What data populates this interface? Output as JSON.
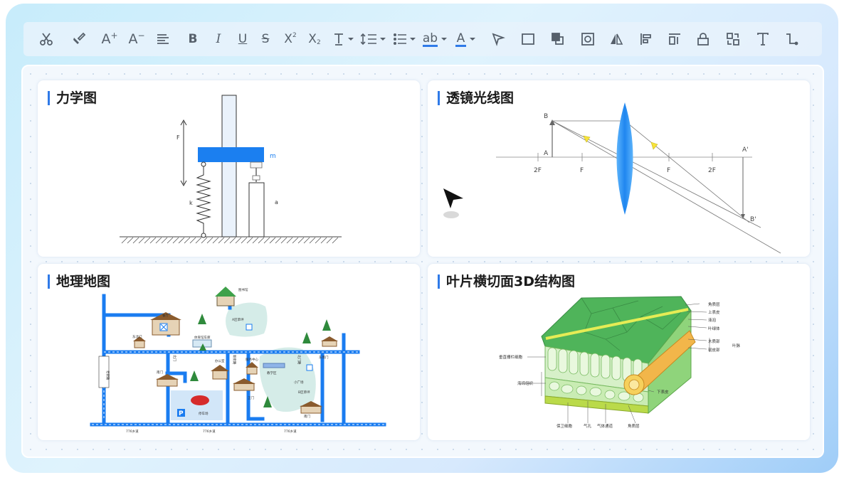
{
  "toolbar": {
    "underline_label": "ab",
    "buttons": [
      "cut",
      "format-painter",
      "increase-font",
      "decrease-font",
      "align",
      "bold",
      "italic",
      "underline",
      "strikethrough",
      "superscript",
      "subscript",
      "text-size",
      "line-spacing",
      "list",
      "text-underline-color",
      "font-color",
      "select",
      "rectangle",
      "crop",
      "group",
      "flip",
      "align-left",
      "distribute",
      "lock",
      "replace",
      "text",
      "connector"
    ]
  },
  "cards": {
    "mechanics": {
      "title": "力学图",
      "label_f": "F",
      "label_m": "m",
      "label_k": "k",
      "label_a": "a"
    },
    "lens": {
      "title": "透镜光线图",
      "label_b": "B",
      "label_a": "A",
      "label_2f_left": "2F",
      "label_f_left": "F",
      "label_f_right": "F",
      "label_2f_right": "2F",
      "label_a_prime": "A'",
      "label_b_prime": "B'"
    },
    "map": {
      "title": "地理地图",
      "labels": {
        "dining": "餐厅",
        "east_gate": "东北门",
        "playground": "体育馆车库",
        "park": "A区草坪",
        "library": "图书馆",
        "north_gate": "北门路",
        "office": "办公室",
        "service": "服务中心",
        "teach_area": "教学区",
        "south_square": "小广场",
        "b_area": "B区草坪",
        "nanmen": "南门",
        "nanmen2": "南门",
        "east_n": "东南门",
        "north_main": "北门",
        "old_street": "老街路",
        "parking": "停车场",
        "road1": "776乡道",
        "road2": "776乡道",
        "road3": "776乡道",
        "gate_south": "正门",
        "xinjie": "新街路",
        "yuejing": "悦景路",
        "north_lane": "北门路"
      }
    },
    "leaf": {
      "title": "叶片横切面3D结构图",
      "labels": {
        "cuticle_top": "角质层",
        "upper_epidermis": "上表皮",
        "vacuole": "液泡",
        "chloroplast": "叶绿体",
        "xylem": "木质部",
        "phloem": "韧皮部",
        "vein": "叶脉",
        "palisade": "垂直栅栏细胞",
        "spongy": "海绵组织",
        "lower_epidermis": "下表皮",
        "guard": "保卫细胞",
        "stoma": "气孔",
        "air_channel": "气体通道",
        "cuticle_bottom": "角质层"
      }
    }
  },
  "colors": {
    "accent": "#2f7ae8",
    "icon": "#56606b",
    "road": "#1a7cf0",
    "leaf_dark": "#3fa14a",
    "leaf_light": "#8fd47b",
    "lens": "#1f86f0",
    "triangle": "#f7e33b"
  }
}
